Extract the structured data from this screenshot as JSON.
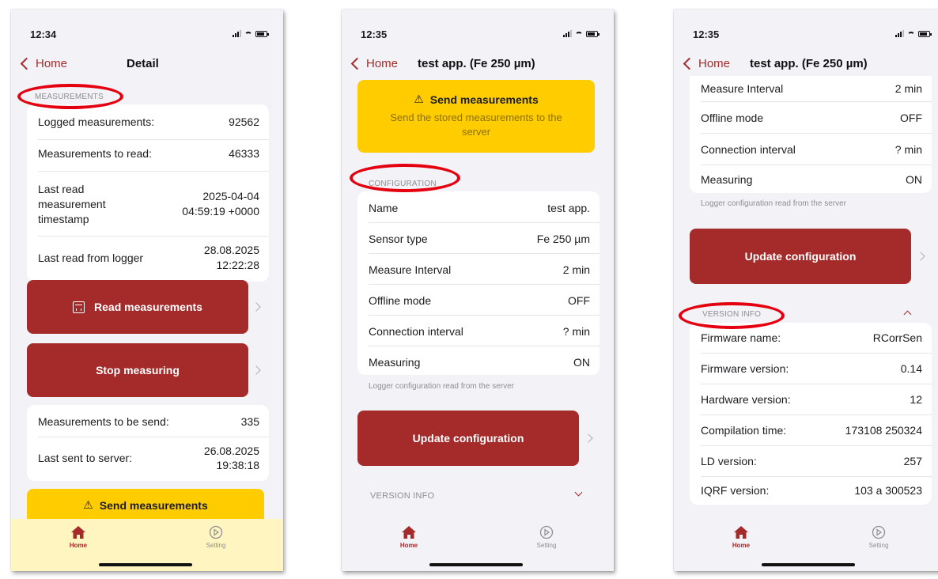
{
  "colors": {
    "accent": "#a52a2a",
    "warning": "#ffcc00",
    "highlight_ring": "#e4000f"
  },
  "screen1": {
    "time": "12:34",
    "back": "Home",
    "title": "Detail",
    "section": "MEASUREMENTS",
    "card1": [
      {
        "label": "Logged measurements:",
        "value": "92562"
      },
      {
        "label": "Measurements to read:",
        "value": "46333"
      },
      {
        "label": "Last read measurement timestamp",
        "value": "2025-04-04 04:59:19 +0000"
      },
      {
        "label": "Last read from logger",
        "value": "28.08.2025 12:22:28"
      }
    ],
    "read_button": "Read measurements",
    "stop_button": "Stop measuring",
    "card2": [
      {
        "label": "Measurements to be send:",
        "value": "335"
      },
      {
        "label": "Last sent to server:",
        "value": "26.08.2025 19:38:18"
      }
    ],
    "send_title": "Send measurements"
  },
  "screen2": {
    "time": "12:35",
    "back": "Home",
    "title": "test app. (Fe 250 µm)",
    "send_title": "Send measurements",
    "send_subtitle": "Send the stored measurements to the server",
    "section": "CONFIGURATION",
    "config": [
      {
        "label": "Name",
        "value": "test app."
      },
      {
        "label": "Sensor type",
        "value": "Fe 250 µm"
      },
      {
        "label": "Measure Interval",
        "value": "2 min"
      },
      {
        "label": "Offline mode",
        "value": "OFF"
      },
      {
        "label": "Connection interval",
        "value": "? min"
      },
      {
        "label": "Measuring",
        "value": "ON"
      }
    ],
    "footnote": "Logger configuration read from the server",
    "update_button": "Update configuration",
    "version_section": "VERSION INFO"
  },
  "screen3": {
    "time": "12:35",
    "back": "Home",
    "title": "test app. (Fe 250 µm)",
    "config": [
      {
        "label": "Measure Interval",
        "value": "2 min"
      },
      {
        "label": "Offline mode",
        "value": "OFF"
      },
      {
        "label": "Connection interval",
        "value": "? min"
      },
      {
        "label": "Measuring",
        "value": "ON"
      }
    ],
    "footnote": "Logger configuration read from the server",
    "update_button": "Update configuration",
    "version_section": "VERSION INFO",
    "version": [
      {
        "label": "Firmware name:",
        "value": "RCorrSen"
      },
      {
        "label": "Firmware version:",
        "value": "0.14"
      },
      {
        "label": "Hardware version:",
        "value": "12"
      },
      {
        "label": "Compilation time:",
        "value": "173108 250324"
      },
      {
        "label": "LD version:",
        "value": "257"
      },
      {
        "label": "IQRF version:",
        "value": "103 a 300523"
      }
    ]
  },
  "tabbar": {
    "home": "Home",
    "setting": "Setting"
  }
}
